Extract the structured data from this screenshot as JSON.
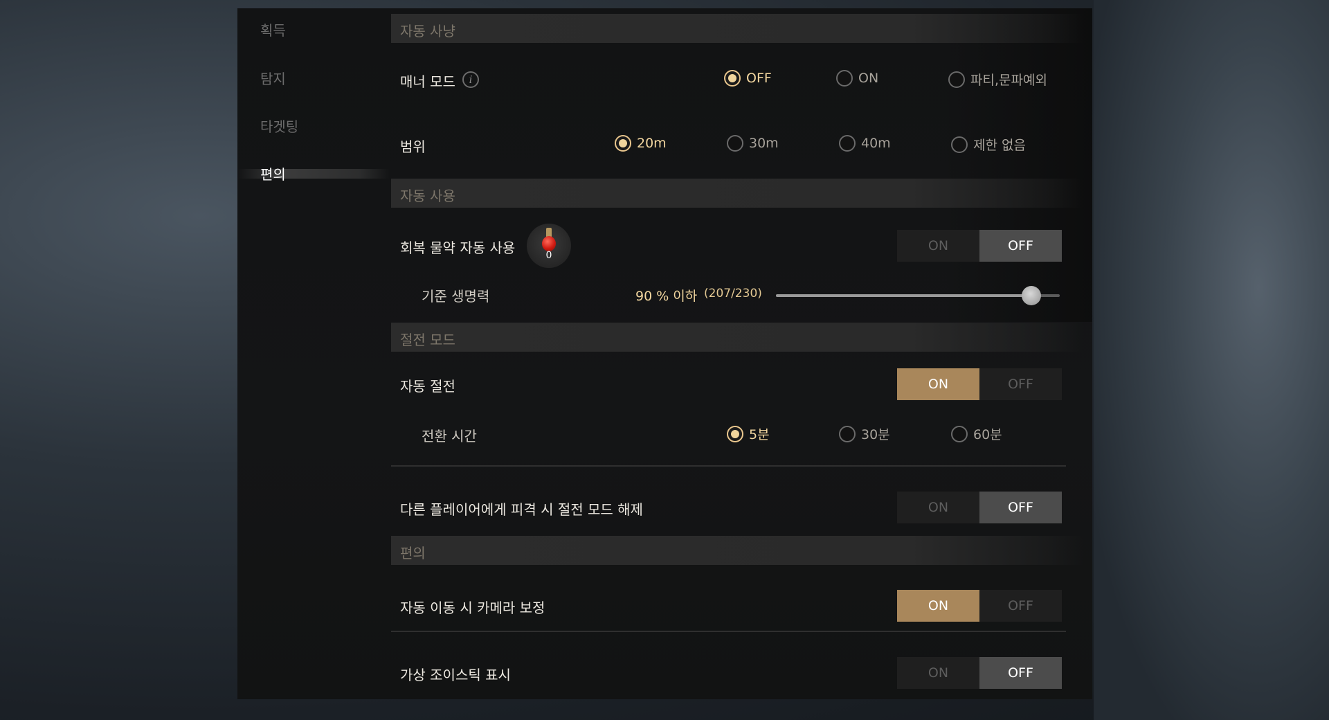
{
  "nav": {
    "items": [
      {
        "label": "획득"
      },
      {
        "label": "탐지"
      },
      {
        "label": "타겟팅"
      },
      {
        "label": "편의"
      }
    ],
    "active": "편의"
  },
  "sections": {
    "auto_hunt": "자동 사냥",
    "auto_use": "자동 사용",
    "power_save": "절전 모드",
    "convenience": "편의"
  },
  "auto_hunt": {
    "manner_mode": {
      "label": "매너 모드",
      "info_icon": "info-icon",
      "options": [
        "OFF",
        "ON",
        "파티,문파예외"
      ],
      "selected": "OFF"
    },
    "range": {
      "label": "범위",
      "options": [
        "20m",
        "30m",
        "40m",
        "제한 없음"
      ],
      "selected": "20m"
    }
  },
  "auto_use": {
    "potion": {
      "label": "회복 물약 자동 사용",
      "icon": "potion-icon",
      "count": "0",
      "on_label": "ON",
      "off_label": "OFF",
      "value": "OFF"
    },
    "threshold": {
      "label": "기준 생명력",
      "value_text": "90 % 이하",
      "detail_text": "(207/230)",
      "percent": 90
    }
  },
  "power_save": {
    "auto": {
      "label": "자동 절전",
      "on_label": "ON",
      "off_label": "OFF",
      "value": "ON"
    },
    "switch_time": {
      "label": "전환 시간",
      "options": [
        "5분",
        "30분",
        "60분"
      ],
      "selected": "5분"
    },
    "release_on_hit": {
      "label": "다른 플레이어에게 피격 시 절전 모드 해제",
      "on_label": "ON",
      "off_label": "OFF",
      "value": "OFF"
    }
  },
  "convenience": {
    "camera_correction": {
      "label": "자동 이동 시 카메라 보정",
      "on_label": "ON",
      "off_label": "OFF",
      "value": "ON"
    },
    "virtual_joystick": {
      "label": "가상 조이스틱 표시",
      "on_label": "ON",
      "off_label": "OFF",
      "value": "OFF"
    }
  },
  "colors": {
    "accent_gold": "#a9875b",
    "selected_text": "#f3d7a0",
    "panel_bg": "#131415"
  }
}
